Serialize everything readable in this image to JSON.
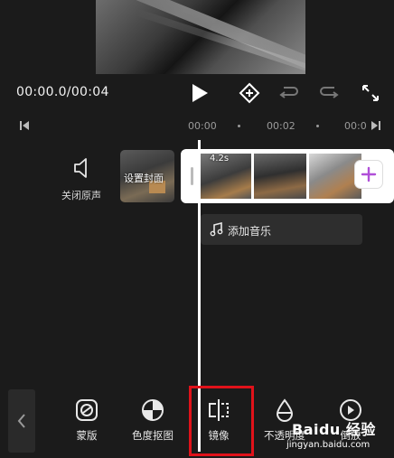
{
  "player": {
    "timecode": "00:00.0/00:04"
  },
  "ruler": {
    "ticks": [
      "00:00",
      "00:02",
      "00:0"
    ]
  },
  "tracks": {
    "mute_label": "关闭原声",
    "cover_label": "设置封面",
    "clip_duration": "4.2s",
    "music_label": "添加音乐"
  },
  "toolbar": {
    "items": [
      {
        "label": "蒙版",
        "icon": "mask-icon"
      },
      {
        "label": "色度抠图",
        "icon": "chroma-key-icon"
      },
      {
        "label": "镜像",
        "icon": "mirror-icon"
      },
      {
        "label": "不透明度",
        "icon": "opacity-icon"
      },
      {
        "label": "倒放",
        "icon": "reverse-icon"
      }
    ],
    "highlight_color": "#e0121a"
  },
  "watermark": {
    "brand": "Baidu 经验",
    "url": "jingyan.baidu.com"
  },
  "colors": {
    "background": "#1b1b1b",
    "highlight": "#e0121a"
  }
}
